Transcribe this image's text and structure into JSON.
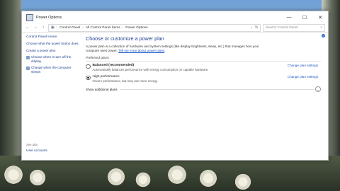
{
  "window": {
    "title": "Power Options",
    "controls": {
      "minimize": "—",
      "maximize": "☐",
      "close": "✕"
    }
  },
  "address": {
    "breadcrumbs": [
      "Control Panel",
      "All Control Panel Items",
      "Power Options"
    ],
    "search_placeholder": "Search Control Panel"
  },
  "sidebar": {
    "home": "Control Panel Home",
    "links": [
      "Choose what the power button does",
      "Create a power plan",
      "Choose when to turn off the display",
      "Change when the computer sleeps"
    ],
    "see_also_heading": "See also",
    "see_also_links": [
      "User Accounts"
    ]
  },
  "main": {
    "title": "Choose or customize a power plan",
    "description": "A power plan is a collection of hardware and system settings (like display brightness, sleep, etc.) that manages how your computer uses power.",
    "tell_more": "Tell me more about power plans",
    "group_label": "Preferred plans",
    "plans": [
      {
        "name": "Balanced (recommended)",
        "desc": "Automatically balances performance with energy consumption on capable hardware.",
        "link": "Change plan settings",
        "selected": false
      },
      {
        "name": "High performance",
        "desc": "Favors performance, but may use more energy.",
        "link": "Change plan settings",
        "selected": true
      }
    ],
    "show_additional": "Show additional plans"
  },
  "icons": {
    "help": "help-icon",
    "back": "back-arrow-icon",
    "forward": "forward-arrow-icon",
    "up": "up-arrow-icon",
    "refresh": "refresh-icon",
    "search": "search-icon"
  },
  "colors": {
    "link": "#1a56c7",
    "title": "#1e3d8f"
  }
}
